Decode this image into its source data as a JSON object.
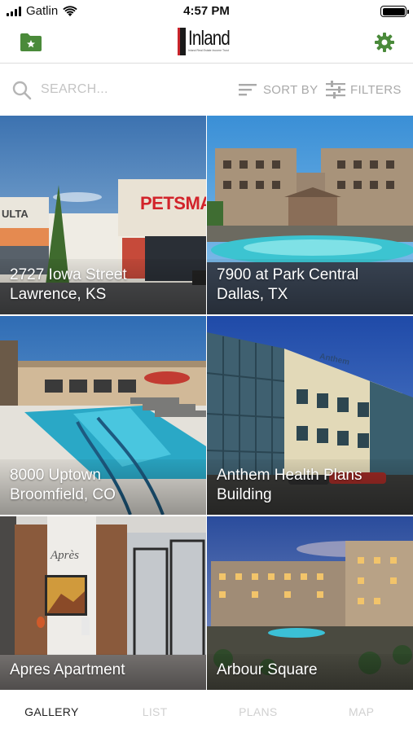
{
  "status_bar": {
    "carrier": "Gatlin",
    "time": "4:57 PM"
  },
  "nav": {
    "logo_word": "Inland",
    "logo_subtext": "Inland Real Estate Income Trust",
    "folder_icon": "folder-star-icon",
    "settings_icon": "gear-icon",
    "accent_color": "#4a8a3a"
  },
  "search": {
    "placeholder": "SEARCH...",
    "sort_label": "SORT BY",
    "filters_label": "FILTERS"
  },
  "properties": [
    {
      "name": "2727 Iowa Street",
      "location": "Lawrence, KS"
    },
    {
      "name": "7900 at Park Central",
      "location": "Dallas, TX"
    },
    {
      "name": "8000 Uptown",
      "location": "Broomfield, CO"
    },
    {
      "name": "Anthem Health Plans Building",
      "location": ""
    },
    {
      "name": "Apres Apartment",
      "location": ""
    },
    {
      "name": "Arbour Square",
      "location": ""
    }
  ],
  "tabs": [
    {
      "label": "GALLERY",
      "active": true
    },
    {
      "label": "LIST",
      "active": false
    },
    {
      "label": "PLANS",
      "active": false
    },
    {
      "label": "MAP",
      "active": false
    }
  ]
}
